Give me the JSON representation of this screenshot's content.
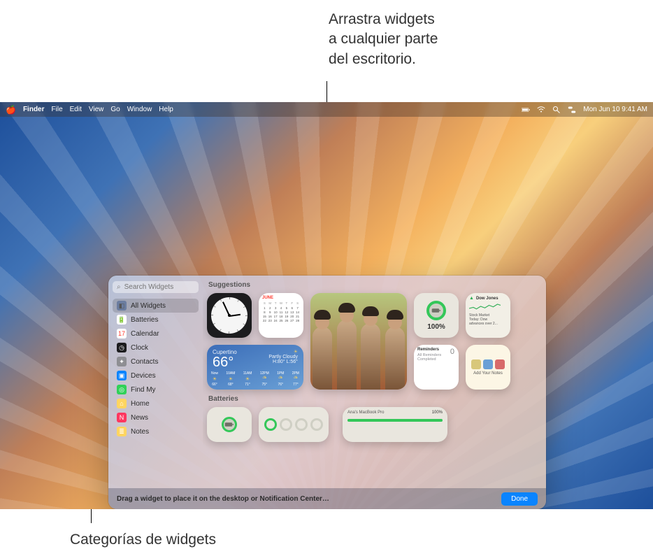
{
  "callouts": {
    "top": "Arrastra widgets\na cualquier parte\ndel escritorio.",
    "bottom": "Categorías de widgets"
  },
  "menubar": {
    "app": "Finder",
    "items": [
      "File",
      "Edit",
      "View",
      "Go",
      "Window",
      "Help"
    ],
    "datetime": "Mon Jun 10  9:41 AM"
  },
  "gallery": {
    "search_placeholder": "Search Widgets",
    "categories": [
      {
        "label": "All Widgets",
        "selected": true,
        "icon_bg": "#6b7da0",
        "glyph": "◧"
      },
      {
        "label": "Batteries",
        "icon_bg": "#ffffff",
        "glyph": "🔋",
        "fg": "#34c759"
      },
      {
        "label": "Calendar",
        "icon_bg": "#ffffff",
        "glyph": "17",
        "fg": "#ff3b30"
      },
      {
        "label": "Clock",
        "icon_bg": "#1c1c1e",
        "glyph": "◷",
        "fg": "#fff"
      },
      {
        "label": "Contacts",
        "icon_bg": "#8e8e93",
        "glyph": "✦",
        "fg": "#fff"
      },
      {
        "label": "Devices",
        "icon_bg": "#0a84ff",
        "glyph": "▣",
        "fg": "#fff"
      },
      {
        "label": "Find My",
        "icon_bg": "#30d158",
        "glyph": "◎",
        "fg": "#fff"
      },
      {
        "label": "Home",
        "icon_bg": "#ffd560",
        "glyph": "⌂",
        "fg": "#fff"
      },
      {
        "label": "News",
        "icon_bg": "#ff375f",
        "glyph": "N",
        "fg": "#fff"
      },
      {
        "label": "Notes",
        "icon_bg": "#ffd560",
        "glyph": "≣",
        "fg": "#fff"
      }
    ],
    "sections": {
      "suggestions": "Suggestions",
      "batteries": "Batteries"
    },
    "weather": {
      "location": "Cupertino",
      "temp": "66°",
      "cond_icon": "☀︎",
      "cond": "Partly Cloudy",
      "range": "H:80° L:56°",
      "hours": [
        {
          "t": "Now",
          "i": "☀︎",
          "d": "66°"
        },
        {
          "t": "10AM",
          "i": "☀︎",
          "d": "68°"
        },
        {
          "t": "11AM",
          "i": "☀︎",
          "d": "71°"
        },
        {
          "t": "12PM",
          "i": "⛅︎",
          "d": "75°"
        },
        {
          "t": "1PM",
          "i": "⛅︎",
          "d": "76°"
        },
        {
          "t": "2PM",
          "i": "⛅︎",
          "d": "77°"
        }
      ]
    },
    "calendar": {
      "month": "June",
      "dow": [
        "S",
        "M",
        "T",
        "W",
        "T",
        "F",
        "S"
      ]
    },
    "battery": {
      "pct": "100%"
    },
    "stocks": {
      "sym": "Dow Jones",
      "l1": "Stock Market",
      "l2": "Today: Dow",
      "l3": "advances over 2..."
    },
    "reminders": {
      "title": "Reminders",
      "count": "0",
      "sub": "All Reminders\nCompleted"
    },
    "notes": {
      "label": "Add Your Notes"
    },
    "batt_wide": {
      "owner": "Ana's MacBook Pro",
      "pct": "100%"
    },
    "footer_hint": "Drag a widget to place it on the desktop or Notification Center…",
    "done": "Done"
  }
}
